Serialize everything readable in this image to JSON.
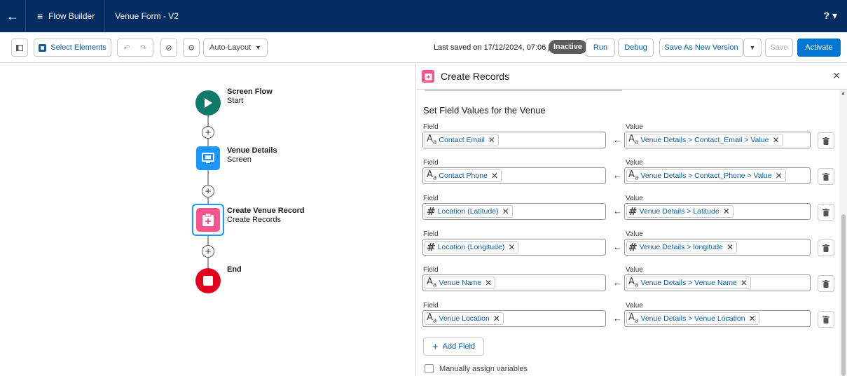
{
  "app": {
    "title": "Flow Builder",
    "flow_name": "Venue Form - V2",
    "help": "? ▾"
  },
  "toolbar": {
    "select_elements": "Select Elements",
    "layout": "Auto-Layout",
    "saved_text": "Last saved on 17/12/2024, 07:06 pm",
    "status_badge": "Inactive",
    "run": "Run",
    "debug": "Debug",
    "save_as_new": "Save As New Version",
    "save": "Save",
    "activate": "Activate"
  },
  "canvas": {
    "nodes": [
      {
        "title": "Screen Flow",
        "subtitle": "Start"
      },
      {
        "title": "Venue Details",
        "subtitle": "Screen"
      },
      {
        "title": "Create Venue Record",
        "subtitle": "Create Records"
      },
      {
        "title": "End",
        "subtitle": ""
      }
    ]
  },
  "panel": {
    "title": "Create Records",
    "section_title": "Set Field Values for the Venue",
    "field_label": "Field",
    "value_label": "Value",
    "rows": [
      {
        "field": "Contact Email",
        "field_type": "text",
        "value": "Venue Details > Contact_Email > Value",
        "value_type": "text"
      },
      {
        "field": "Contact Phone",
        "field_type": "text",
        "value": "Venue Details > Contact_Phone > Value",
        "value_type": "text"
      },
      {
        "field": "Location (Latitude)",
        "field_type": "number",
        "value": "Venue Details > Latitude",
        "value_type": "number"
      },
      {
        "field": "Location (Longitude)",
        "field_type": "number",
        "value": "Venue Details > longitude",
        "value_type": "number"
      },
      {
        "field": "Venue Name",
        "field_type": "text",
        "value": "Venue Details > Venue Name",
        "value_type": "text"
      },
      {
        "field": "Venue Location",
        "field_type": "text",
        "value": "Venue Details > Venue Location",
        "value_type": "text"
      }
    ],
    "add_field": "Add Field",
    "manual_assign": "Manually assign variables"
  },
  "colors": {
    "nav": "#032d60",
    "brand": "#0176d3",
    "start_node": "#0e7b6a",
    "screen_node": "#1b96ff",
    "create_node": "#f5548c",
    "end_node": "#e3001b"
  }
}
